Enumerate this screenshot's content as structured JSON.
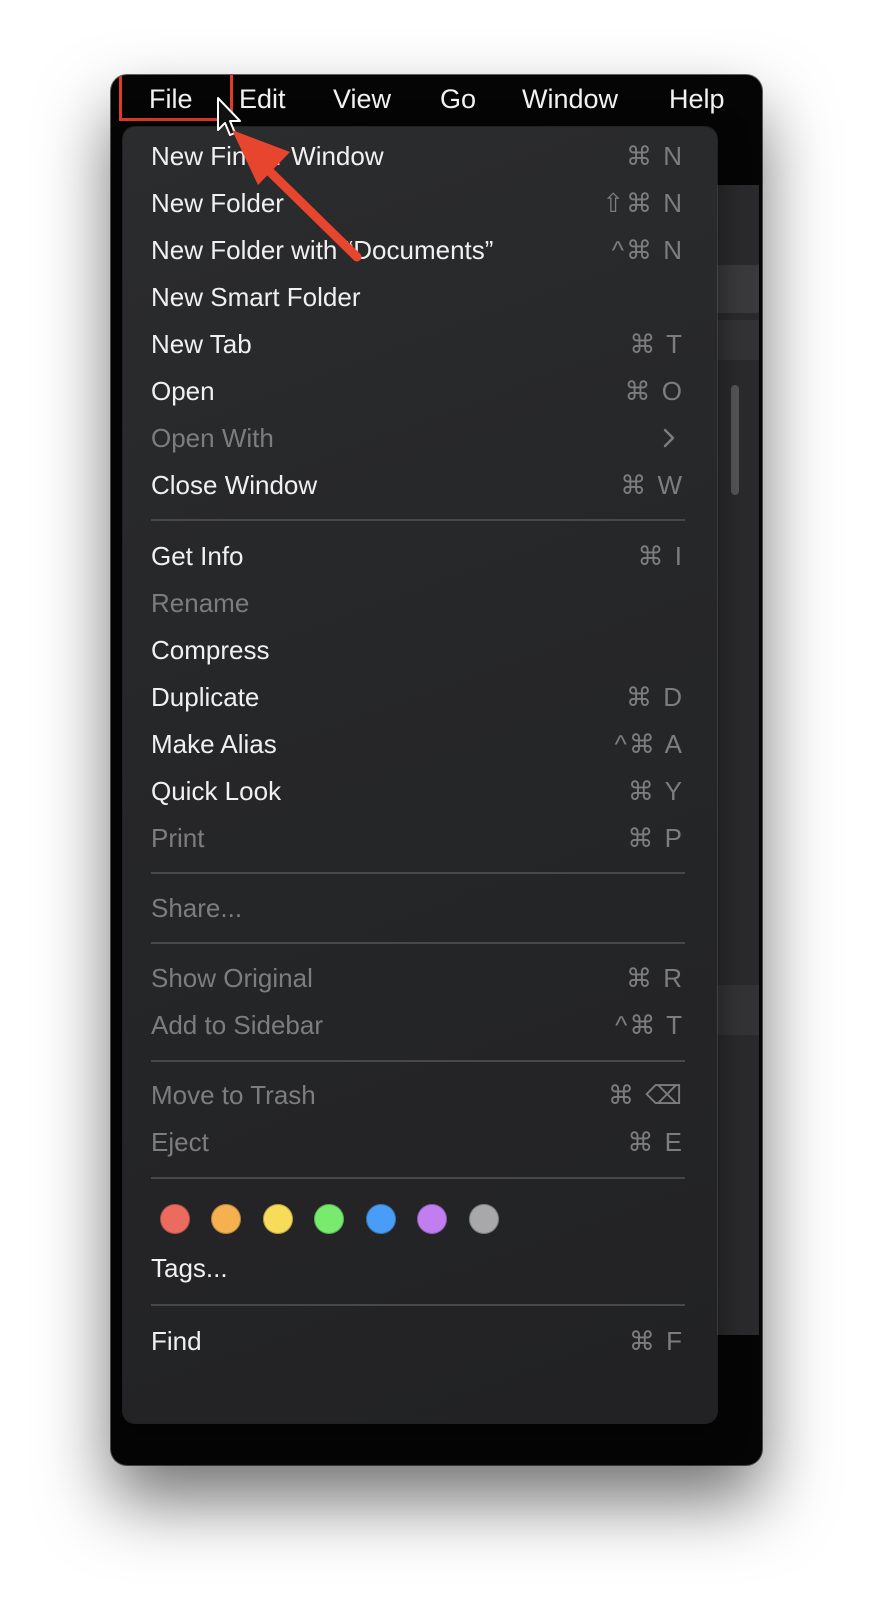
{
  "menubar": {
    "items": [
      {
        "label": "File"
      },
      {
        "label": "Edit"
      },
      {
        "label": "View"
      },
      {
        "label": "Go"
      },
      {
        "label": "Window"
      },
      {
        "label": "Help"
      }
    ]
  },
  "file_menu": {
    "items": [
      {
        "label": "New Finder Window",
        "shortcut": "⌘ N",
        "enabled": true
      },
      {
        "label": "New Folder",
        "shortcut": "⇧⌘ N",
        "enabled": true
      },
      {
        "label": "New Folder with “Documents”",
        "shortcut": "^⌘ N",
        "enabled": true
      },
      {
        "label": "New Smart Folder",
        "shortcut": "",
        "enabled": true
      },
      {
        "label": "New Tab",
        "shortcut": "⌘ T",
        "enabled": true
      },
      {
        "label": "Open",
        "shortcut": "⌘ O",
        "enabled": true
      },
      {
        "label": "Open With",
        "shortcut": "",
        "enabled": false,
        "submenu": true
      },
      {
        "label": "Close Window",
        "shortcut": "⌘ W",
        "enabled": true
      },
      {
        "label": "Get Info",
        "shortcut": "⌘ I",
        "enabled": true
      },
      {
        "label": "Rename",
        "shortcut": "",
        "enabled": false
      },
      {
        "label": "Compress",
        "shortcut": "",
        "enabled": true
      },
      {
        "label": "Duplicate",
        "shortcut": "⌘ D",
        "enabled": true
      },
      {
        "label": "Make Alias",
        "shortcut": "^⌘ A",
        "enabled": true
      },
      {
        "label": "Quick Look",
        "shortcut": "⌘ Y",
        "enabled": true
      },
      {
        "label": "Print",
        "shortcut": "⌘ P",
        "enabled": false
      },
      {
        "label": "Share...",
        "shortcut": "",
        "enabled": false
      },
      {
        "label": "Show Original",
        "shortcut": "⌘ R",
        "enabled": false
      },
      {
        "label": "Add to Sidebar",
        "shortcut": "^⌘ T",
        "enabled": false
      },
      {
        "label": "Move to Trash",
        "shortcut": "⌘ ⌫",
        "enabled": false
      },
      {
        "label": "Eject",
        "shortcut": "⌘ E",
        "enabled": false
      },
      {
        "label": "Tags...",
        "shortcut": "",
        "enabled": true
      },
      {
        "label": "Find",
        "shortcut": "⌘ F",
        "enabled": true
      }
    ],
    "tag_colors": [
      "#ec6b5f",
      "#f5b050",
      "#f7dc5a",
      "#78ea6e",
      "#4a9df6",
      "#c17ef0",
      "#a8a8aa"
    ]
  },
  "colors": {
    "highlight": "#e03a2a",
    "menu_bg": "#262729",
    "text": "#f0f0f0",
    "disabled_text": "#7d7d7f"
  }
}
